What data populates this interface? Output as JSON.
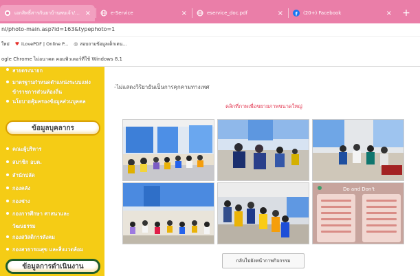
{
  "tabs": [
    {
      "title": "เอกสิทธิ์สารกันยาบ้านพบเจ้า/เพียงนา/คมฯ",
      "icon": "site-icon"
    },
    {
      "title": "e-Service",
      "icon": "globe-icon"
    },
    {
      "title": "eservice_doc.pdf",
      "icon": "globe-icon"
    },
    {
      "title": "(20+) Facebook",
      "icon": "facebook-icon"
    }
  ],
  "new_tab_label": "+",
  "address": "nl/photo-main.asp?id=163&typephoto=1",
  "bookmarks": [
    {
      "label": "ใหม่",
      "icon": "apps-icon"
    },
    {
      "label": "iLovePDF | Online P...",
      "icon": "ilovepdf-icon"
    },
    {
      "label": "สอบถามข้อมูลเด็กเดน...",
      "icon": "globe-icon"
    }
  ],
  "infobar_text": "ogle Chrome ไม่อนาคต คอมพิวเตอร์ที่ใช้ Windows 8.1",
  "sidebar": {
    "links_top": [
      "สายตรงนายก",
      "มาตรฐานกำหนดตำแหน่งระบบแท่ง",
      "ข้าราชการส่วนท้องถิ่น",
      "นโยบายคุ้มครองข้อมูลส่วนบุคคล"
    ],
    "banner_personnel": "ข้อมูลบุคลากร",
    "links_personnel": [
      "คณะผู้บริหาร",
      "สมาชิก อบต.",
      "สำนักปลัด",
      "กองคลัง",
      "กองช่าง",
      "กองการศึกษา ศาสนาและ",
      "วัฒนธรรม",
      "กองสวัสดิการสังคม",
      "กองสาธารณสุข และสิ่งแวดล้อม"
    ],
    "banner_operations": "ข้อมูลการดำเนินงาน"
  },
  "main": {
    "note": "-ไม่แสดงวิริยาธันเป็นการคุกคามทางเพศ",
    "enlarge_link": "คลิกที่ภาพเพื่อขยายภาพขนาดใหญ่",
    "photo6_caption": "Do and Don't",
    "back_button": "กลับไปยังหน้ากาพกิจกรรม"
  },
  "colors": {
    "tabbar": "#ea7ea8",
    "sidebar": "#f5cc15",
    "link_red": "#e2364f"
  }
}
